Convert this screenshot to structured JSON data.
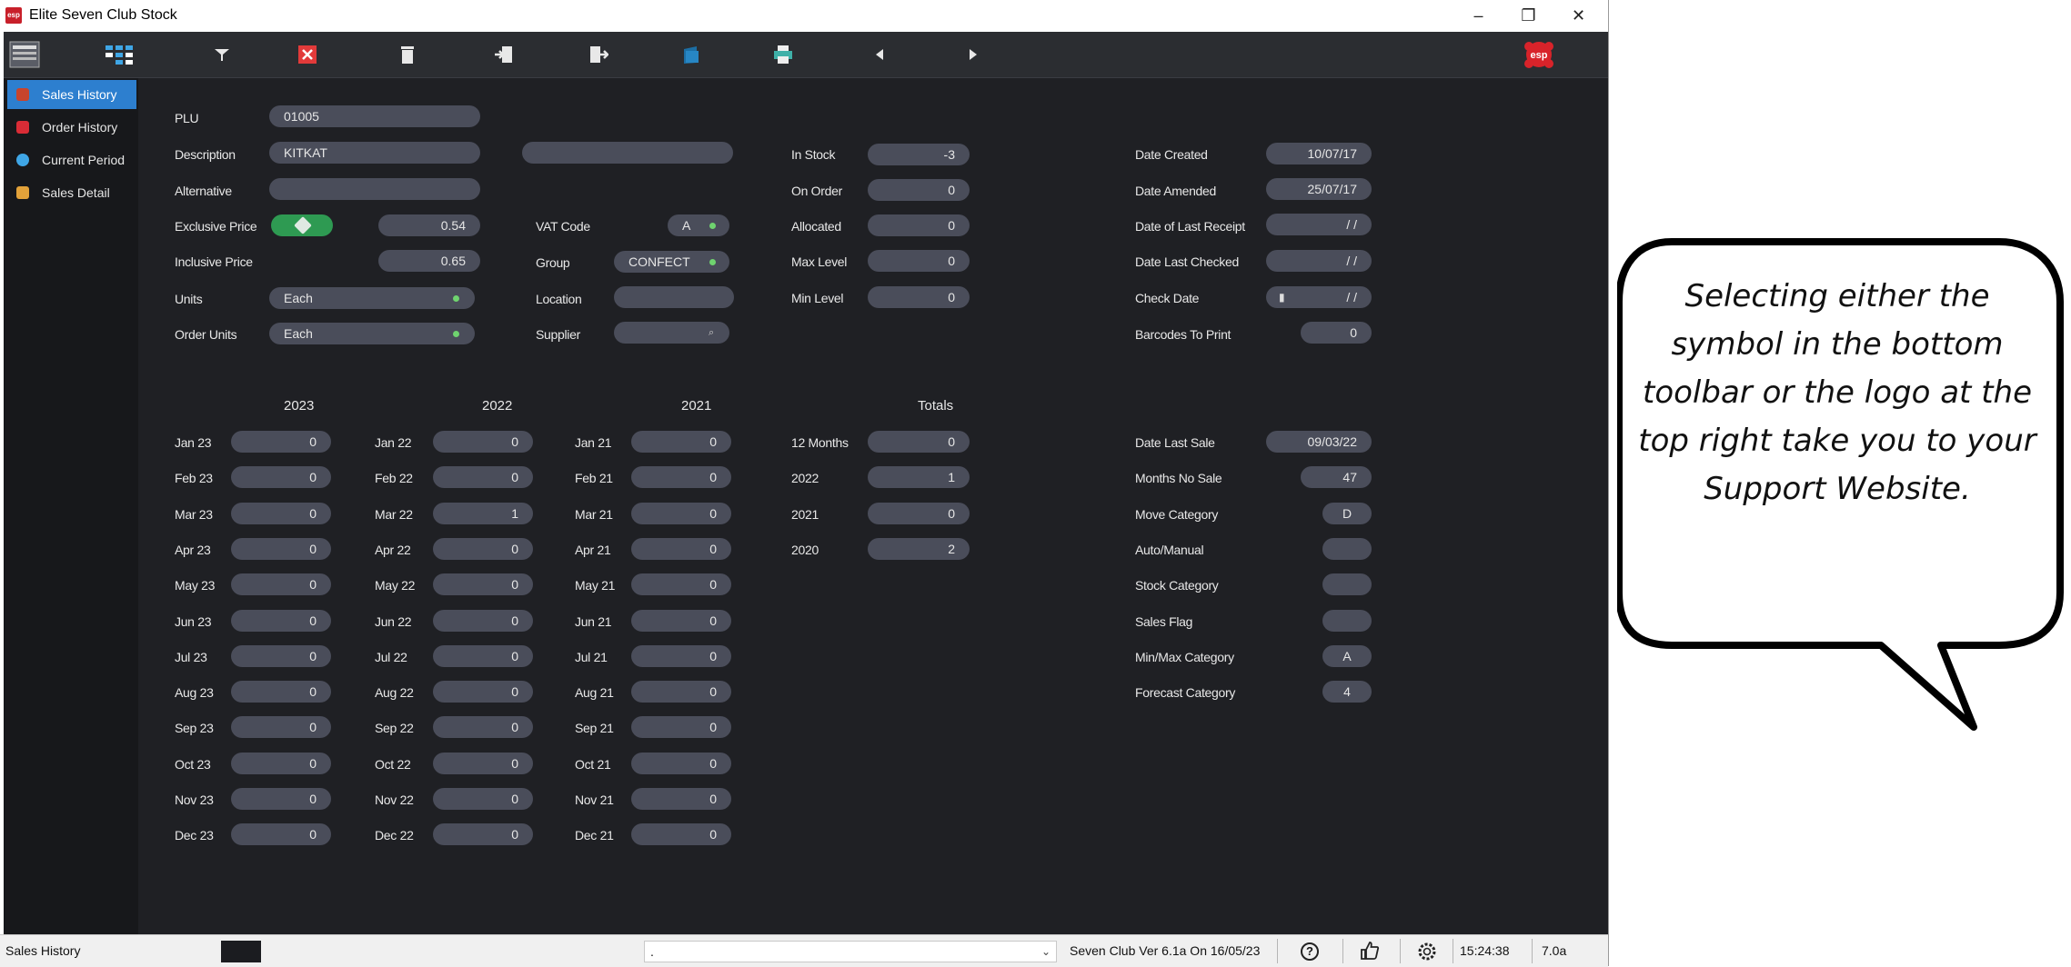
{
  "window": {
    "title": "Elite Seven Club Stock",
    "controls": [
      "–",
      "❐",
      "✕"
    ]
  },
  "toolbar": {
    "icons": [
      "stock-list-icon",
      "grid-icon",
      "filter-icon",
      "delete-red-icon",
      "trash-icon",
      "import-icon",
      "export-icon",
      "book-icon",
      "print-icon",
      "previous-arrow-icon",
      "next-arrow-icon",
      "esp-logo-icon"
    ],
    "logo_text": "esp",
    "accent": "#2d7fcf"
  },
  "sidebar": {
    "items": [
      {
        "label": "Sales History",
        "icon": "sales-history-icon",
        "active": true
      },
      {
        "label": "Order History",
        "icon": "order-history-icon",
        "active": false
      },
      {
        "label": "Current Period",
        "icon": "current-period-icon",
        "active": false
      },
      {
        "label": "Sales Detail",
        "icon": "sales-detail-icon",
        "active": false
      }
    ]
  },
  "product": {
    "plu_label": "PLU",
    "plu": "01005",
    "description_label": "Description",
    "description": "KITKAT",
    "description2": "",
    "alternative_label": "Alternative",
    "alternative": "",
    "exclusive_price_label": "Exclusive Price",
    "exclusive_price": "0.54",
    "inclusive_price_label": "Inclusive Price",
    "inclusive_price": "0.65",
    "units_label": "Units",
    "units": "Each",
    "order_units_label": "Order Units",
    "order_units": "Each",
    "vat_code_label": "VAT Code",
    "vat_code": "A",
    "group_label": "Group",
    "group": "CONFECT",
    "location_label": "Location",
    "location": "",
    "supplier_label": "Supplier",
    "supplier": ""
  },
  "stock": {
    "in_stock_label": "In Stock",
    "in_stock": "-3",
    "on_order_label": "On Order",
    "on_order": "0",
    "allocated_label": "Allocated",
    "allocated": "0",
    "max_level_label": "Max Level",
    "max_level": "0",
    "min_level_label": "Min Level",
    "min_level": "0"
  },
  "dates": {
    "date_created_label": "Date Created",
    "date_created": "10/07/17",
    "date_amended_label": "Date Amended",
    "date_amended": "25/07/17",
    "last_receipt_label": "Date of Last Receipt",
    "last_receipt": "/ /",
    "last_checked_label": "Date Last Checked",
    "last_checked": "/ /",
    "check_date_label": "Check Date",
    "check_date": "/ /",
    "barcodes_label": "Barcodes To Print",
    "barcodes": "0"
  },
  "history": {
    "years": [
      "2023",
      "2022",
      "2021"
    ],
    "col2023": [
      {
        "m": "Jan 23",
        "v": "0"
      },
      {
        "m": "Feb 23",
        "v": "0"
      },
      {
        "m": "Mar 23",
        "v": "0"
      },
      {
        "m": "Apr 23",
        "v": "0"
      },
      {
        "m": "May 23",
        "v": "0"
      },
      {
        "m": "Jun 23",
        "v": "0"
      },
      {
        "m": "Jul 23",
        "v": "0"
      },
      {
        "m": "Aug 23",
        "v": "0"
      },
      {
        "m": "Sep 23",
        "v": "0"
      },
      {
        "m": "Oct 23",
        "v": "0"
      },
      {
        "m": "Nov 23",
        "v": "0"
      },
      {
        "m": "Dec 23",
        "v": "0"
      }
    ],
    "col2022": [
      {
        "m": "Jan 22",
        "v": "0"
      },
      {
        "m": "Feb 22",
        "v": "0"
      },
      {
        "m": "Mar 22",
        "v": "1"
      },
      {
        "m": "Apr 22",
        "v": "0"
      },
      {
        "m": "May 22",
        "v": "0"
      },
      {
        "m": "Jun 22",
        "v": "0"
      },
      {
        "m": "Jul 22",
        "v": "0"
      },
      {
        "m": "Aug 22",
        "v": "0"
      },
      {
        "m": "Sep 22",
        "v": "0"
      },
      {
        "m": "Oct 22",
        "v": "0"
      },
      {
        "m": "Nov 22",
        "v": "0"
      },
      {
        "m": "Dec 22",
        "v": "0"
      }
    ],
    "col2021": [
      {
        "m": "Jan 21",
        "v": "0"
      },
      {
        "m": "Feb 21",
        "v": "0"
      },
      {
        "m": "Mar 21",
        "v": "0"
      },
      {
        "m": "Apr 21",
        "v": "0"
      },
      {
        "m": "May 21",
        "v": "0"
      },
      {
        "m": "Jun 21",
        "v": "0"
      },
      {
        "m": "Jul 21",
        "v": "0"
      },
      {
        "m": "Aug 21",
        "v": "0"
      },
      {
        "m": "Sep 21",
        "v": "0"
      },
      {
        "m": "Oct 21",
        "v": "0"
      },
      {
        "m": "Nov 21",
        "v": "0"
      },
      {
        "m": "Dec 21",
        "v": "0"
      }
    ]
  },
  "totals": {
    "header": "Totals",
    "rows": [
      {
        "label": "12 Months",
        "v": "0"
      },
      {
        "label": "2022",
        "v": "1"
      },
      {
        "label": "2021",
        "v": "0"
      },
      {
        "label": "2020",
        "v": "2"
      }
    ]
  },
  "categories": {
    "rows": [
      {
        "label": "Date Last Sale",
        "v": "09/03/22",
        "wide": true
      },
      {
        "label": "Months No Sale",
        "v": "47",
        "wide": false
      },
      {
        "label": "Move Category",
        "v": "D",
        "wide": false
      },
      {
        "label": "Auto/Manual",
        "v": "",
        "wide": false
      },
      {
        "label": "Stock Category",
        "v": "",
        "wide": false
      },
      {
        "label": "Sales Flag",
        "v": "",
        "wide": false
      },
      {
        "label": "Min/Max Category",
        "v": "A",
        "wide": false
      },
      {
        "label": "Forecast Category",
        "v": "4",
        "wide": false
      }
    ]
  },
  "statusbar": {
    "page": "Sales History",
    "dropdown": ".",
    "version": "Seven Club Ver 6.1a On 16/05/23",
    "time": "15:24:38",
    "build": "7.0a"
  },
  "callout": {
    "text": "Selecting either the symbol in the bottom toolbar or the  logo at the top right take you to your Support Website."
  }
}
